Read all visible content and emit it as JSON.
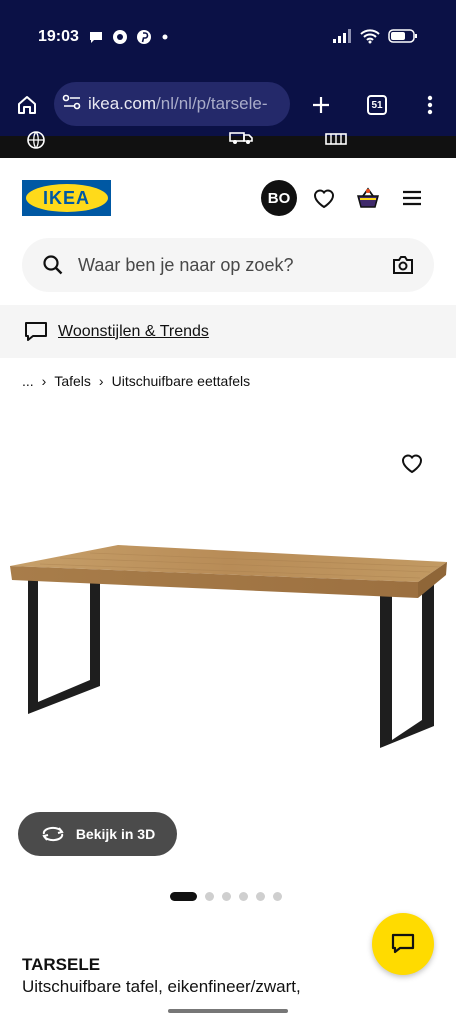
{
  "status_bar": {
    "time": "19:03",
    "notification_icons": [
      "chat-icon",
      "chrome-icon",
      "pinterest-icon",
      "dot-icon"
    ],
    "system_icons": [
      "signal-icon",
      "wifi-icon",
      "battery-icon"
    ]
  },
  "browser": {
    "url_main": "ikea.com",
    "url_path": "/nl/nl/p/tarsele-",
    "tab_count": "51"
  },
  "header": {
    "logo_text": "IKEA",
    "avatar_initials": "BO"
  },
  "search": {
    "placeholder": "Waar ben je naar op zoek?"
  },
  "promo": {
    "label": "Woonstijlen & Trends"
  },
  "breadcrumb": {
    "ellipsis": "...",
    "items": [
      "Tafels",
      "Uitschuifbare eettafels"
    ]
  },
  "product": {
    "view_3d_label": "Bekijk in 3D",
    "name": "TARSELE",
    "description": "Uitschuifbare tafel, eikenfineer/zwart,",
    "gallery": {
      "count": 6,
      "active_index": 0
    }
  },
  "colors": {
    "browser_bg": "#0b1146",
    "ikea_blue": "#0058a3",
    "ikea_yellow": "#ffda1a",
    "chat_yellow": "#ffdb00"
  }
}
